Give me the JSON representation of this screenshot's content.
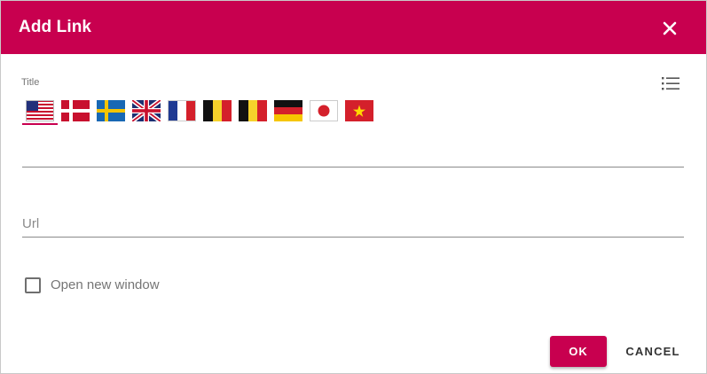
{
  "dialog": {
    "title": "Add Link",
    "close_icon": "close-icon"
  },
  "title_field": {
    "label": "Title",
    "value": "",
    "list_icon": "list-icon"
  },
  "languages": [
    {
      "code": "en-US",
      "flag": "us-flag-icon",
      "selected": true
    },
    {
      "code": "da",
      "flag": "denmark-flag-icon",
      "selected": false
    },
    {
      "code": "sv",
      "flag": "sweden-flag-icon",
      "selected": false
    },
    {
      "code": "en-GB",
      "flag": "uk-flag-icon",
      "selected": false
    },
    {
      "code": "fr",
      "flag": "france-flag-icon",
      "selected": false
    },
    {
      "code": "nl-BE",
      "flag": "belgium-flag-icon",
      "selected": false
    },
    {
      "code": "fr-BE",
      "flag": "belgium-flag-icon",
      "selected": false
    },
    {
      "code": "de",
      "flag": "germany-flag-icon",
      "selected": false
    },
    {
      "code": "ja",
      "flag": "japan-flag-icon",
      "selected": false
    },
    {
      "code": "vi",
      "flag": "vietnam-flag-icon",
      "selected": false
    }
  ],
  "url_field": {
    "placeholder": "Url",
    "value": ""
  },
  "open_new_window": {
    "label": "Open new window",
    "checked": false
  },
  "actions": {
    "ok_label": "OK",
    "cancel_label": "CANCEL"
  },
  "colors": {
    "accent": "#c8004f"
  }
}
